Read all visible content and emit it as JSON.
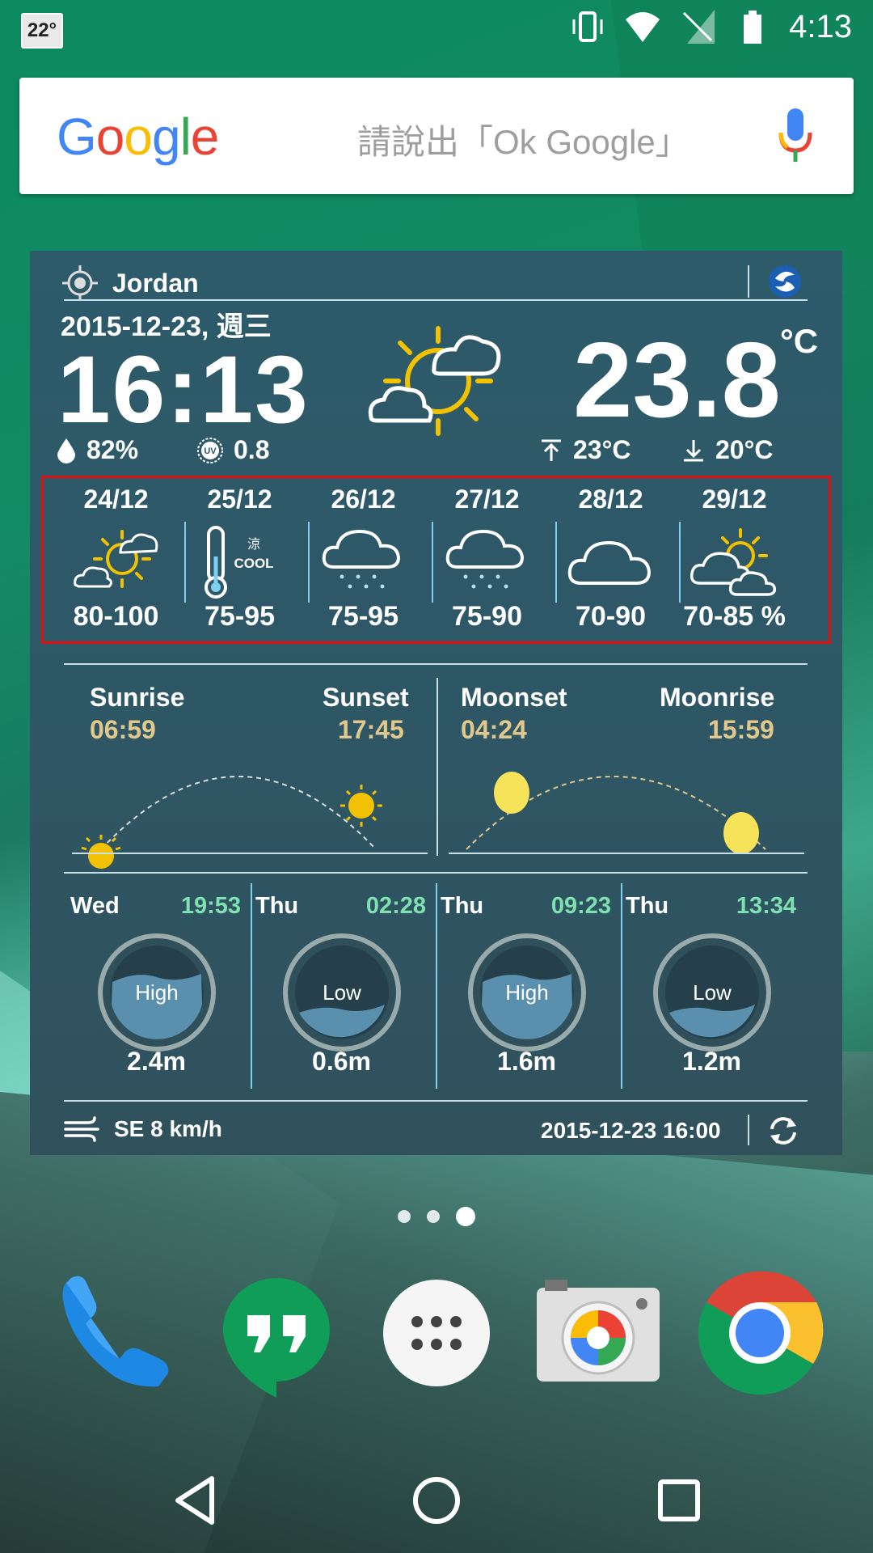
{
  "status_bar": {
    "temp_badge": "22°",
    "clock": "4:13",
    "icons": [
      "vibrate-icon",
      "wifi-icon",
      "no-sim-icon",
      "battery-icon"
    ]
  },
  "search": {
    "logo": "Google",
    "hint": "請說出「Ok Google」"
  },
  "widget": {
    "location": "Jordan",
    "date": "2015-12-23, 週三",
    "time": "16:13",
    "temperature": "23.8",
    "unit": "°C",
    "humidity": "82%",
    "uv": "0.8",
    "max_temp": "23°C",
    "min_temp": "20°C",
    "forecast": [
      {
        "date": "24/12",
        "icon": "sun-cloud-icon",
        "range": "80-100"
      },
      {
        "date": "25/12",
        "icon": "thermometer-cool-icon",
        "range": "75-95",
        "cool_cn": "涼",
        "cool_en": "COOL"
      },
      {
        "date": "26/12",
        "icon": "rain-cloud-icon",
        "range": "75-95"
      },
      {
        "date": "27/12",
        "icon": "rain-cloud-icon",
        "range": "75-90"
      },
      {
        "date": "28/12",
        "icon": "cloud-icon",
        "range": "70-90"
      },
      {
        "date": "29/12",
        "icon": "sun-clouds-icon",
        "range": "70-85 %"
      }
    ],
    "astro": {
      "sunrise_label": "Sunrise",
      "sunrise": "06:59",
      "sunset_label": "Sunset",
      "sunset": "17:45",
      "moonset_label": "Moonset",
      "moonset": "04:24",
      "moonrise_label": "Moonrise",
      "moonrise": "15:59"
    },
    "tides": [
      {
        "day": "Wed",
        "time": "19:53",
        "type": "High",
        "height": "2.4m",
        "level": 0.7
      },
      {
        "day": "Thu",
        "time": "02:28",
        "type": "Low",
        "height": "0.6m",
        "level": 0.3
      },
      {
        "day": "Thu",
        "time": "09:23",
        "type": "High",
        "height": "1.6m",
        "level": 0.7
      },
      {
        "day": "Thu",
        "time": "13:34",
        "type": "Low",
        "height": "1.2m",
        "level": 0.3
      }
    ],
    "wind": "SE 8 km/h",
    "updated": "2015-12-23 16:00"
  },
  "page_dots": {
    "count": 3,
    "active": 2
  },
  "dock": [
    "phone-app-icon",
    "hangouts-app-icon",
    "app-drawer-icon",
    "camera-app-icon",
    "chrome-app-icon"
  ],
  "nav": [
    "back-button",
    "home-button",
    "recents-button"
  ],
  "colors": {
    "widget_bg": "#2e5867",
    "accent_yellow": "#e2c98b",
    "tide_time": "#7fe0b0",
    "divider_blue": "#7fd0ee",
    "highlight_red": "#e01010"
  }
}
